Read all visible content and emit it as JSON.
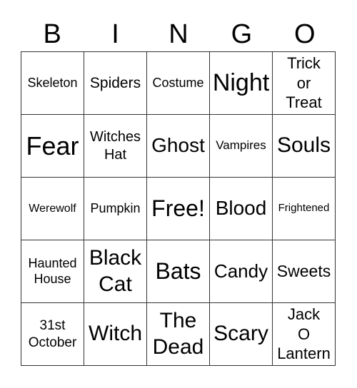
{
  "header": [
    "B",
    "I",
    "N",
    "G",
    "O"
  ],
  "cells": [
    "Skeleton",
    "Spiders",
    "Costume",
    "Night",
    "Trick\nor\nTreat",
    "Fear",
    "Witches\nHat",
    "Ghost",
    "Vampires",
    "Souls",
    "Werewolf",
    "Pumpkin",
    "Free!",
    "Blood",
    "Frightened",
    "Haunted\nHouse",
    "Black\nCat",
    "Bats",
    "Candy",
    "Sweets",
    "31st\nOctober",
    "Witch",
    "The\nDead",
    "Scary",
    "Jack\nO\nLantern"
  ]
}
